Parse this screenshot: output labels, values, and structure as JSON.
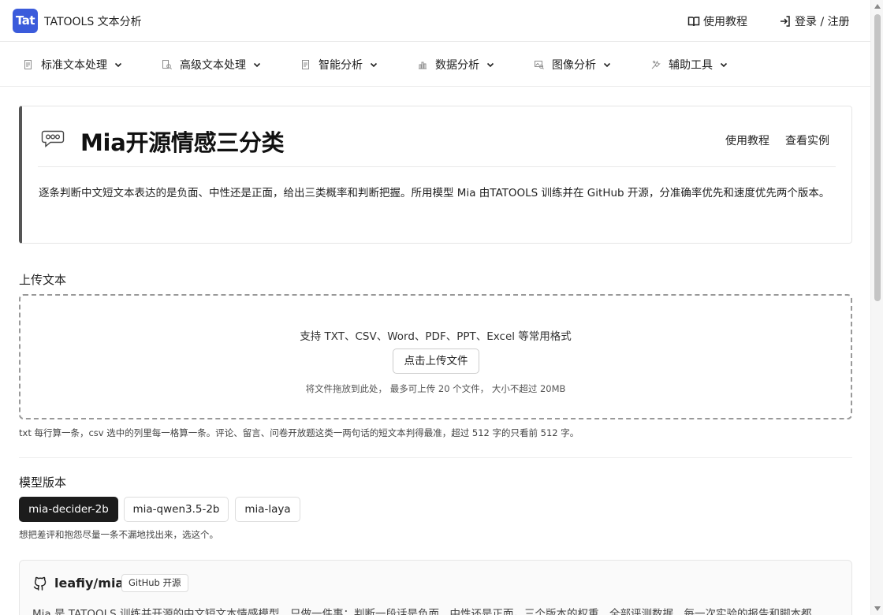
{
  "header": {
    "logo_text": "Tat",
    "app_name": "TATOOLS 文本分析",
    "tutorial_label": "使用教程",
    "login_label": "登录 / 注册"
  },
  "nav": {
    "items": [
      {
        "label": "标准文本处理",
        "icon": "document-icon"
      },
      {
        "label": "高级文本处理",
        "icon": "document-search-icon"
      },
      {
        "label": "智能分析",
        "icon": "document-icon"
      },
      {
        "label": "数据分析",
        "icon": "chart-icon"
      },
      {
        "label": "图像分析",
        "icon": "image-search-icon"
      },
      {
        "label": "辅助工具",
        "icon": "tools-icon"
      }
    ]
  },
  "tool": {
    "title": "Mia开源情感三分类",
    "tutorial_link": "使用教程",
    "example_link": "查看实例",
    "description": "逐条判断中文短文本表达的是负面、中性还是正面，给出三类概率和判断把握。所用模型 Mia 由TATOOLS 训练并在 GitHub 开源，分准确率优先和速度优先两个版本。"
  },
  "upload": {
    "section_label": "上传文本",
    "formats": "支持 TXT、CSV、Word、PDF、PPT、Excel 等常用格式",
    "button_label": "点击上传文件",
    "hint": "将文件拖放到此处， 最多可上传 20 个文件， 大小不超过 20MB",
    "helper": "txt 每行算一条，csv 选中的列里每一格算一条。评论、留言、问卷开放题这类一两句话的短文本判得最准，超过 512 字的只看前 512 字。"
  },
  "model": {
    "section_label": "模型版本",
    "versions": [
      "mia-decider-2b",
      "mia-qwen3.5-2b",
      "mia-laya"
    ],
    "selected": "mia-decider-2b",
    "helper": "想把差评和抱怨尽量一条不漏地找出来，选这个。"
  },
  "repo": {
    "name": "leafiy/mia",
    "badge": "GitHub 开源",
    "description": "Mia 是 TATOOLS 训练并开源的中文短文本情感模型，只做一件事：判断一段话是负面、中性还是正面。三个版本的权重、全部评测数据、每一次实验的报告和脚本都"
  },
  "colors": {
    "logo_bg": "#3b5bdb",
    "active_version_bg": "#1c1c1c"
  }
}
